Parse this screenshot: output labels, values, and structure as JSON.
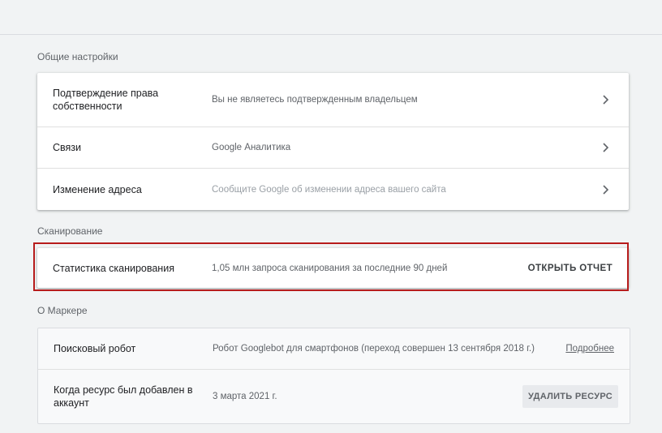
{
  "general": {
    "title": "Общие настройки",
    "rows": [
      {
        "label": "Подтверждение права собственности",
        "value": "Вы не являетесь подтвержденным владельцем"
      },
      {
        "label": "Связи",
        "value": "Google Аналитика"
      },
      {
        "label": "Изменение адреса",
        "value": "Сообщите Google об изменении адреса вашего сайта"
      }
    ]
  },
  "crawling": {
    "title": "Сканирование",
    "row": {
      "label": "Статистика сканирования",
      "value": "1,05 млн запроса сканирования за последние 90 дней",
      "action": "ОТКРЫТЬ ОТЧЕТ"
    }
  },
  "about": {
    "title": "О Маркере",
    "rows": [
      {
        "label": "Поисковый робот",
        "value": "Робот Googlebot для смартфонов (переход совершен 13 сентября 2018 г.)",
        "link": "Подробнее"
      },
      {
        "label": "Когда ресурс был добавлен в аккаунт",
        "value": "3 марта 2021 г.",
        "button": "УДАЛИТЬ РЕСУРС"
      }
    ]
  },
  "colors": {
    "highlight": "#b71c1c",
    "background": "#f1f3f4"
  }
}
